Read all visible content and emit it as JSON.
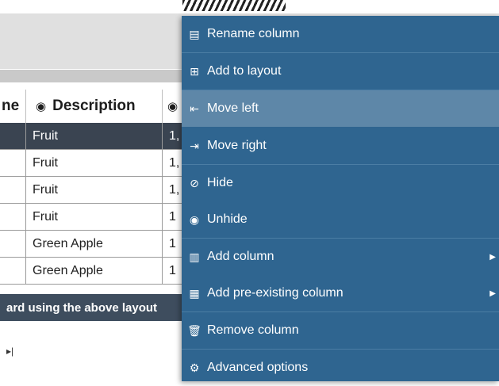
{
  "table": {
    "header": {
      "col1": "ne",
      "col2": "Description",
      "col3": ""
    },
    "rows": [
      {
        "desc": "Fruit",
        "extra": "1,",
        "selected": true
      },
      {
        "desc": "Fruit",
        "extra": "1,",
        "selected": false
      },
      {
        "desc": "Fruit",
        "extra": "1,",
        "selected": false
      },
      {
        "desc": "Fruit",
        "extra": "1",
        "selected": false
      },
      {
        "desc": "Green Apple",
        "extra": "1",
        "selected": false
      },
      {
        "desc": "Green Apple",
        "extra": "1",
        "selected": false
      }
    ],
    "footer": "ard using the above layout",
    "pager_icon": "▸|"
  },
  "context_menu": {
    "items": [
      {
        "label": "Rename column",
        "icon": "rename-icon",
        "glyph": "▤"
      },
      {
        "label": "Add to layout",
        "icon": "add-to-layout-icon",
        "glyph": "⊞"
      },
      {
        "label": "Move left",
        "icon": "move-left-icon",
        "glyph": "⇤"
      },
      {
        "label": "Move right",
        "icon": "move-right-icon",
        "glyph": "⇥"
      },
      {
        "label": "Hide",
        "icon": "hide-icon",
        "glyph": "⊘"
      },
      {
        "label": "Unhide",
        "icon": "unhide-icon",
        "glyph": "◉"
      },
      {
        "label": "Add column",
        "icon": "add-column-icon",
        "glyph": "▥"
      },
      {
        "label": "Add pre-existing column",
        "icon": "add-pre-existing-column-icon",
        "glyph": "▦"
      },
      {
        "label": "Remove column",
        "icon": "trash-icon",
        "glyph": "🗑"
      },
      {
        "label": "Advanced options",
        "icon": "gear-icon",
        "glyph": "⚙"
      }
    ],
    "hover_item": "Move left"
  },
  "colors": {
    "menu_bg": "#2f6590",
    "menu_hover": "#5e87a8",
    "selected_row": "#3a4451",
    "footer_bg": "#3e4d5e"
  }
}
